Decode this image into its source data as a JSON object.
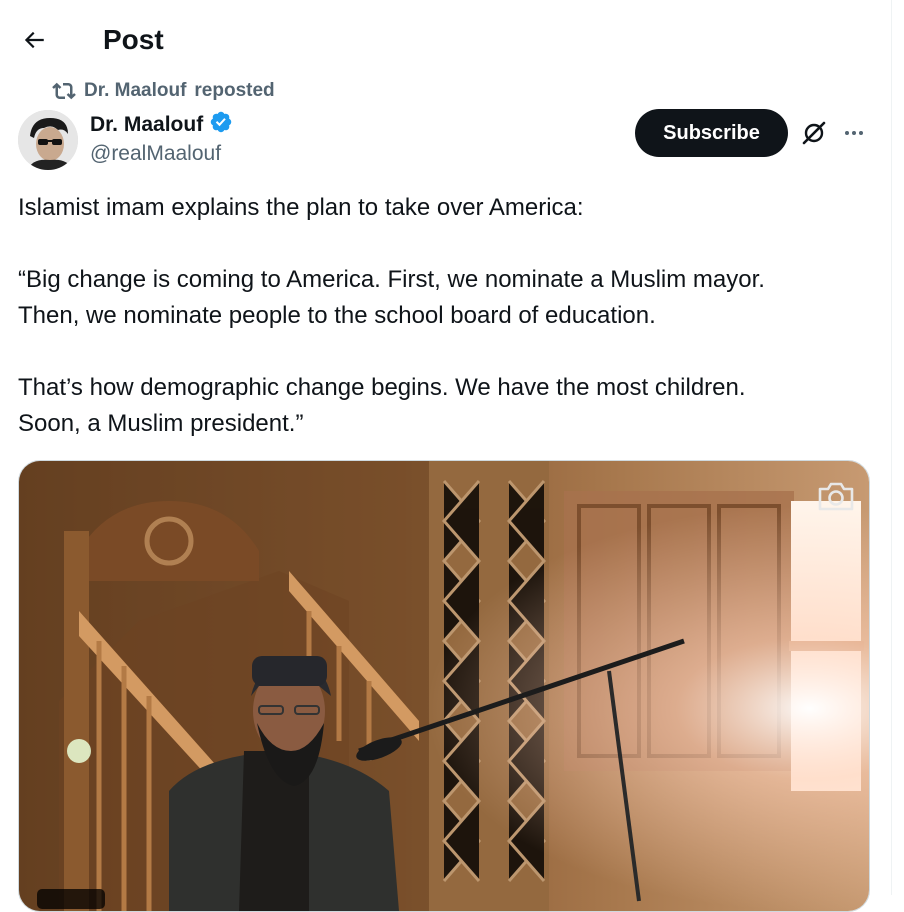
{
  "header": {
    "title": "Post",
    "back_icon": "arrow-left-icon"
  },
  "repost": {
    "icon": "repost-icon",
    "user": "Dr. Maalouf",
    "label": "reposted"
  },
  "author": {
    "display_name": "Dr. Maalouf",
    "verified_icon": "verified-badge-icon",
    "verified_color": "#1d9bf0",
    "handle": "@realMaalouf"
  },
  "actions": {
    "subscribe_label": "Subscribe",
    "grok_icon": "grok-icon",
    "more_icon": "more-icon"
  },
  "tweet": {
    "paragraphs": [
      "Islamist imam explains the plan to take over America:",
      "“Big change is coming to America. First, we nominate a Muslim mayor.\nThen, we nominate people to the school board of education.",
      "That’s how demographic change begins. We have the most children.\nSoon, a Muslim president.”"
    ]
  },
  "media": {
    "type": "video",
    "camera_icon": "camera-icon"
  },
  "colors": {
    "text": "#0f1419",
    "secondary": "#536471",
    "button_bg": "#0f1419"
  }
}
